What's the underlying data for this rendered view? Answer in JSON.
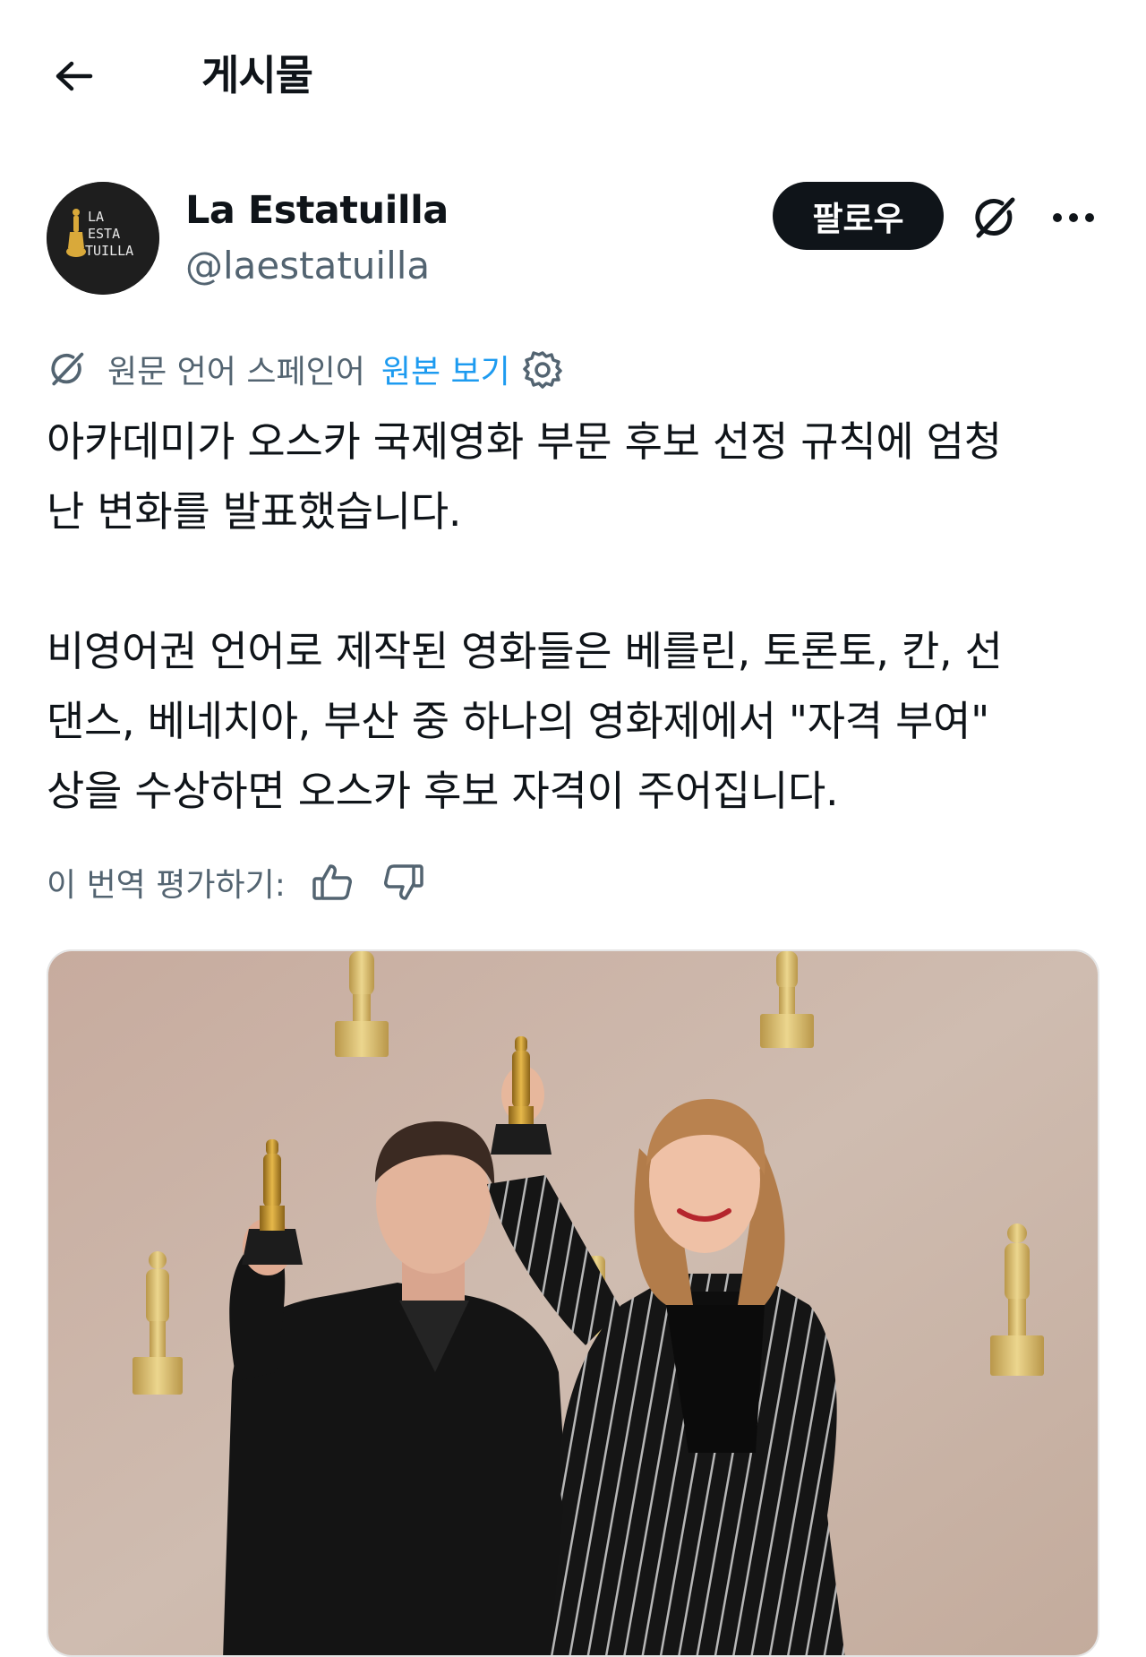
{
  "header": {
    "title": "게시물",
    "back_icon": "arrow-left-icon"
  },
  "author": {
    "name": "La Estatuilla",
    "handle": "@laestatuilla",
    "avatar_lines": [
      "LA",
      "ESTA",
      "TUILLA"
    ]
  },
  "actions": {
    "follow_label": "팔로우",
    "grok_icon": "grok-icon",
    "more_icon": "more-horizontal-icon"
  },
  "translation": {
    "icon": "grok-icon",
    "source_language_text": "원문 언어 스페인어",
    "show_original_label": "원본 보기",
    "settings_icon": "gear-icon"
  },
  "post": {
    "paragraph_1_line_1": "아카데미가 오스카 국제영화 부문 후보 선정 규칙에 엄청",
    "paragraph_1_line_2": "난 변화를 발표했습니다.",
    "paragraph_2_line_1": "비영어권 언어로 제작된 영화들은 베를린, 토론토, 칸, 선",
    "paragraph_2_line_2": "댄스, 베네치아, 부산 중 하나의 영화제에서 \"자격 부여\"",
    "paragraph_2_line_3": "상을 수상하면 오스카 후보 자격이 주어집니다."
  },
  "rating": {
    "label": "이 번역 평가하기:",
    "thumbs_up_icon": "thumbs-up-icon",
    "thumbs_down_icon": "thumbs-down-icon"
  },
  "media": {
    "type": "photo",
    "colors": {
      "backdrop": "#c9b4a6",
      "statue_gold": "#d8bd72",
      "suit_black": "#141414"
    }
  },
  "colors": {
    "text_primary": "#0f1419",
    "text_secondary": "#536471",
    "link": "#1d9bf0",
    "follow_bg": "#0f1419"
  }
}
